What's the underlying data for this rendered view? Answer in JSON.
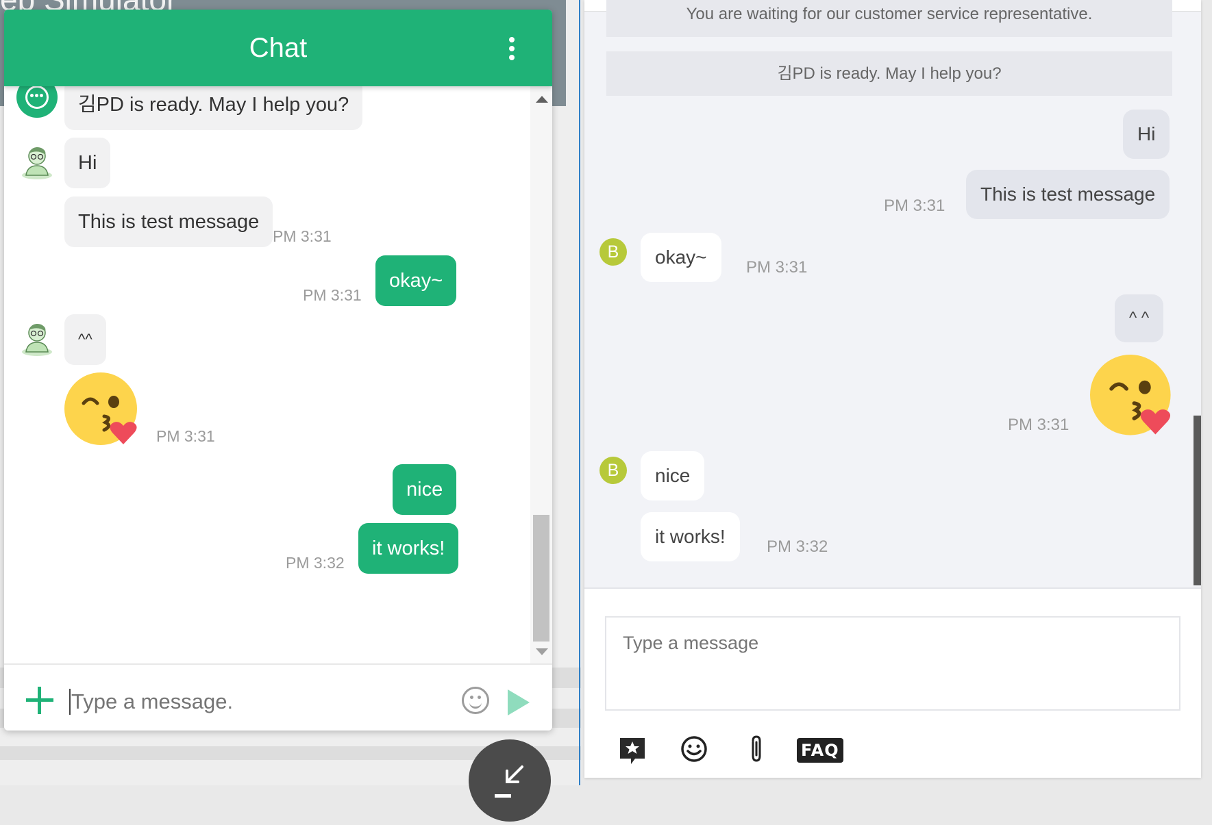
{
  "background": {
    "title_fragment": "eb Simulator"
  },
  "left_chat": {
    "header_title": "Chat",
    "messages": {
      "bot_ready": "김PD is ready. May I help you?",
      "hi": "Hi",
      "test": "This is test message",
      "test_time": "PM 3:31",
      "okay": "okay~",
      "okay_time": "PM 3:31",
      "caret": "^^",
      "emoji_time": "PM 3:31",
      "nice": "nice",
      "works": "it works!",
      "works_time": "PM 3:32"
    },
    "composer_placeholder": "Type a message.",
    "colors": {
      "accent": "#1fb277",
      "send_disabled": "#8fdcbd"
    }
  },
  "right_panel": {
    "system_waiting": "You are waiting for our customer service representative.",
    "system_ready": "김PD is ready. May I help you?",
    "messages": {
      "hi": "Hi",
      "test": "This is test message",
      "test_time": "PM 3:31",
      "okay": "okay~",
      "okay_time": "PM 3:31",
      "caret": "^ ^",
      "emoji_time": "PM 3:31",
      "nice": "nice",
      "works": "it works!",
      "works_time": "PM 3:32"
    },
    "avatar_letter": "B",
    "input_placeholder": "Type a message",
    "toolbar": {
      "faq_label": "FAQ",
      "icons": [
        "star-chat-icon",
        "emoji-icon",
        "paperclip-icon",
        "faq-icon"
      ]
    },
    "colors": {
      "avatar": "#b7c93a",
      "bubble_me": "#e3e5ec",
      "bubble_them": "#ffffff"
    }
  }
}
